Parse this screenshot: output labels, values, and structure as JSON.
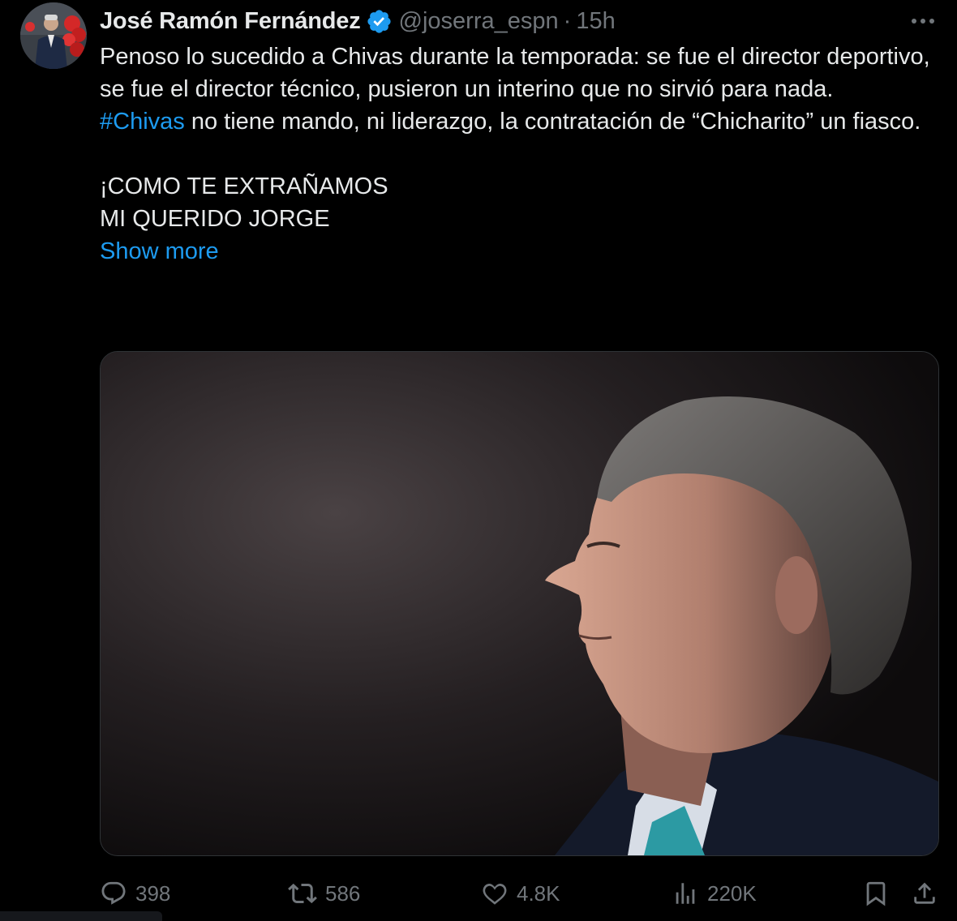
{
  "author": {
    "display_name": "José Ramón Fernández",
    "handle": "@joserra_espn",
    "separator": "·",
    "time": "15h",
    "verified": true
  },
  "tweet": {
    "line1": "Penoso lo sucedido a Chivas durante la temporada: se fue el director deportivo, se fue el director técnico, pusieron un interino que no sirvió para nada.",
    "hashtag": "#Chivas",
    "line2": " no tiene mando, ni liderazgo, la contratación de “Chicharito” un fiasco.",
    "line3": "¡COMO TE EXTRAÑAMOS",
    "line4": "MI QUERIDO JORGE",
    "show_more": "Show more"
  },
  "stats": {
    "replies": "398",
    "reposts": "586",
    "likes": "4.8K",
    "views": "220K"
  },
  "colors": {
    "background": "#000000",
    "text": "#e7e9ea",
    "secondary": "#71767b",
    "accent": "#1d9bf0"
  },
  "icons": {
    "more": "more-icon",
    "verified": "verified-badge-icon",
    "reply": "reply-icon",
    "repost": "repost-icon",
    "like": "heart-icon",
    "views": "views-icon",
    "bookmark": "bookmark-icon",
    "share": "share-icon"
  }
}
